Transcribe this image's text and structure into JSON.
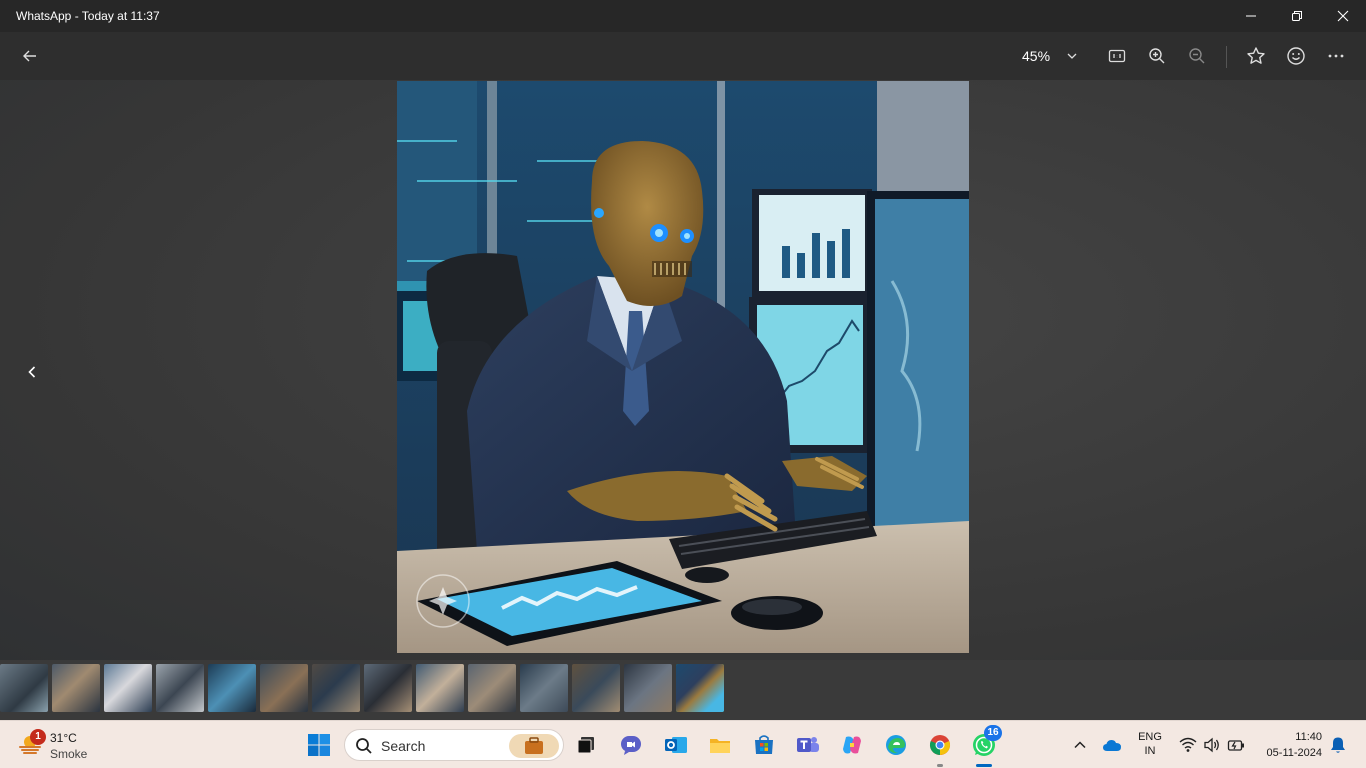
{
  "window": {
    "title": "WhatsApp - Today at 11:37"
  },
  "toolbar": {
    "zoom_value": "45%",
    "icons": [
      "back-arrow-icon",
      "chevron-down-icon",
      "actual-size-icon",
      "zoom-in-icon",
      "zoom-out-icon",
      "star-icon",
      "emoji-icon",
      "more-icon"
    ]
  },
  "viewer": {
    "image_subject": "skeleton-businessman-at-trading-desk",
    "thumbnail_count": 14,
    "selected_thumbnail": 14
  },
  "taskbar": {
    "weather": {
      "badge": "1",
      "temperature": "31°C",
      "condition": "Smoke"
    },
    "search_placeholder": "Search",
    "apps": [
      "start",
      "search",
      "file-explorer-task",
      "meet",
      "outlook",
      "file-explorer",
      "store",
      "teams",
      "copilot",
      "edge",
      "chrome",
      "whatsapp"
    ],
    "whatsapp_badge": "16",
    "language_line1": "ENG",
    "language_line2": "IN",
    "time": "11:40",
    "date": "05-11-2024"
  },
  "colors": {
    "accent_selected": "#3fbf6a",
    "badge_red": "#c42b1c",
    "badge_blue": "#1a73e8"
  }
}
